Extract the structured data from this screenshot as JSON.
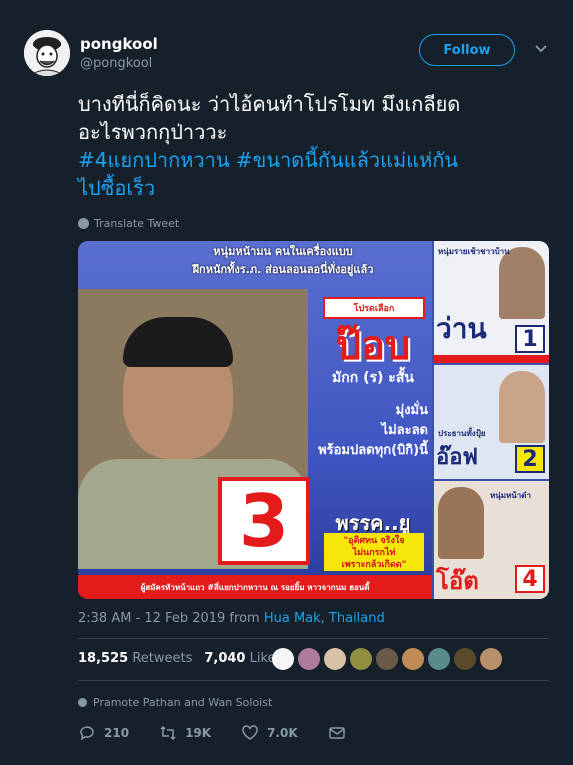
{
  "tweet": {
    "display_name": "pongkool",
    "handle": "@pongkool",
    "follow_label": "Follow",
    "text_line1": "บางทีนี่ก็คิดนะ ว่าไอ้คนทำโปรโมท มึงเกลียด",
    "text_line2": "อะไรพวกกุป่าววะ",
    "hashtag1": "#4แยกปากหวาน",
    "hashtag2": "#ขนาดนี้กันแล้วแม่แห่กัน",
    "hashtag2_cont": "ไปซื้อเร็ว",
    "translate_label": "Translate Tweet",
    "timestamp": "2:38 AM - 12 Feb 2019 from ",
    "location": "Hua Mak, Thailand",
    "retweets_count": "18,525",
    "retweets_label": "Retweets",
    "likes_count": "7,040",
    "likes_label": "Likes",
    "replying_to": "Pramote Pathan and Wan Soloist",
    "reply_count": "210",
    "retweet_action_count": "19K",
    "like_action_count": "7.0K"
  },
  "poster": {
    "headline1": "หนุ่มหน้ามน คนในเครื่องแบบ",
    "headline2": "ฝึกหนักทั้งร.ภ. ส่อนลอนลอนี่ทั่งอยู่แล้ว",
    "party_tag": "โปรดเลือก",
    "nickname": "ป๊อบ",
    "fullname": "มักก (ร) ะสั้น",
    "slogan1": "มุ่งมั่น",
    "slogan2": "ไม่ละลด",
    "slogan3": "พร้อมปลดทุก(บิกิ)นี้",
    "number": "3",
    "party_name": "พรรค..ยู",
    "quote1": "\"อุดิศทน จริงใจ",
    "quote2": "ไม่นกรกไท่",
    "quote3": "เพราะกล้วเกิดด\"",
    "bottom_bar": "ผู้สมัครหัวหน้าแถว #สี่แยกปากหวาน ณ รอยยิ้ม หาวจากนม ฮอนดี้"
  },
  "side_posters": [
    {
      "label": "หนุ่มรายเช้าชาวบ้าน",
      "nickname": "ว่าน",
      "number": "1"
    },
    {
      "label": "ประธานทั้งปุ้ย",
      "nickname": "อ๊อฟ",
      "number": "2"
    },
    {
      "label": "หนุ่มหน้าดำ",
      "nickname": "โอ๊ต",
      "number": "4"
    }
  ],
  "colors": {
    "background": "#15202b",
    "accent": "#1da1f2",
    "muted": "#8899a6",
    "poster_red": "#e31b1b"
  }
}
